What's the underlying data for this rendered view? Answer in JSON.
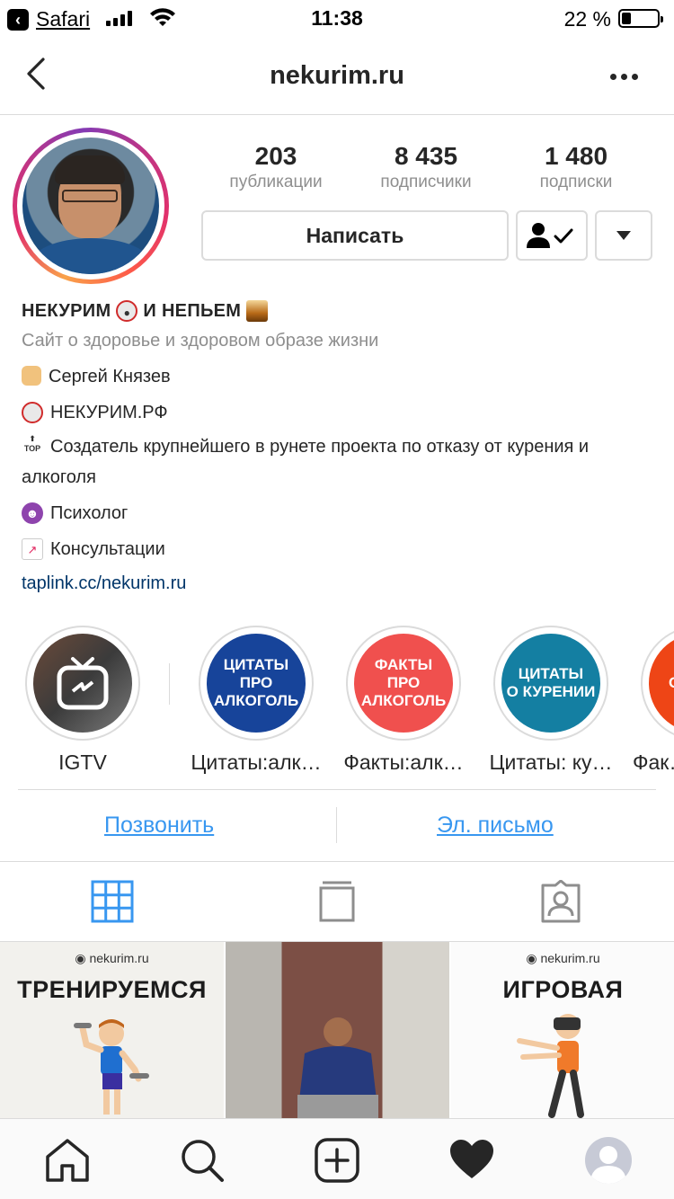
{
  "status_bar": {
    "back_app": "Safari",
    "time": "11:38",
    "battery": "22 %"
  },
  "header": {
    "username": "nekurim.ru"
  },
  "stats": [
    {
      "count": "203",
      "label": "публикации"
    },
    {
      "count": "8 435",
      "label": "подписчики"
    },
    {
      "count": "1 480",
      "label": "подписки"
    }
  ],
  "actions": {
    "message_label": "Написать"
  },
  "bio": {
    "name": "НЕКУРИМ",
    "name_suffix": "И НЕПЬЕМ",
    "category": "Сайт о здоровье и здоровом образе жизни",
    "lines": [
      "Сергей Князев",
      "НЕКУРИМ.РФ",
      "Создатель крупнейшего в рунете проекта по отказу от курения и",
      "алкоголя",
      "Психолог",
      "Консультации"
    ],
    "link": "taplink.cc/nekurim.ru"
  },
  "highlights": [
    {
      "caption": "IGTV",
      "cover_text": []
    },
    {
      "caption": "Цитаты:алк…",
      "cover_text": [
        "ЦИТАТЫ",
        "ПРО АЛКОГОЛЬ"
      ],
      "color": "#17449a"
    },
    {
      "caption": "Факты:алк…",
      "cover_text": [
        "ФАКТЫ",
        "ПРО АЛКОГОЛЬ"
      ],
      "color": "#f0504e"
    },
    {
      "caption": "Цитаты: ку…",
      "cover_text": [
        "ЦИТАТЫ",
        "О КУРЕНИИ"
      ],
      "color": "#147fa2"
    },
    {
      "caption": "Фак…",
      "cover_text": [
        "О"
      ],
      "color": "#ee4516"
    }
  ],
  "contacts": {
    "call": "Позвонить",
    "email": "Эл. письмо"
  },
  "posts": [
    {
      "watermark": "nekurim.ru",
      "title": "ТРЕНИРУЕМСЯ"
    },
    {
      "watermark": "",
      "title": ""
    },
    {
      "watermark": "nekurim.ru",
      "title": "ИГРОВАЯ"
    }
  ],
  "colors": {
    "accent": "#3897f0",
    "link": "#003569",
    "secondary_text": "#8e8e8e"
  }
}
